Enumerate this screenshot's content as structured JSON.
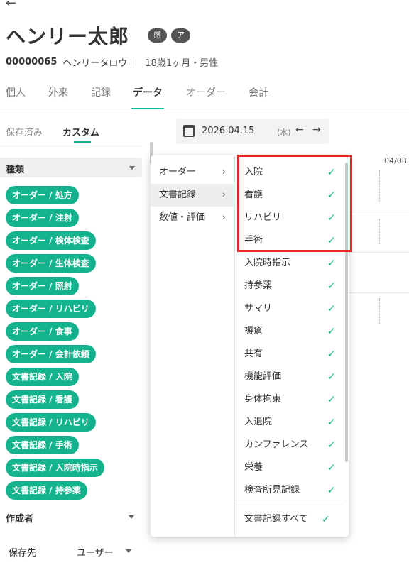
{
  "patient": {
    "name": "ヘンリー太郎",
    "tags": [
      "感",
      "ア"
    ],
    "id": "00000065",
    "kana": "ヘンリータロウ",
    "age_sex": "18歳1ヶ月・男性"
  },
  "tabs": [
    "個人",
    "外来",
    "記録",
    "データ",
    "オーダー",
    "会計"
  ],
  "active_tab": "データ",
  "subtabs": [
    "保存済み",
    "カスタム"
  ],
  "filters": {
    "category_label": "種類",
    "chips": [
      "オーダー / 処方",
      "オーダー / 注射",
      "オーダー / 検体検査",
      "オーダー / 生体検査",
      "オーダー / 照射",
      "オーダー / リハビリ",
      "オーダー / 食事",
      "オーダー / 会計依頼",
      "文書記録 / 入院",
      "文書記録 / 看護",
      "文書記録 / リハビリ",
      "文書記録 / 手術",
      "文書記録 / 入院時指示",
      "文書記録 / 持参薬"
    ],
    "author_label": "作成者",
    "save_label": "保存先",
    "save_value": "ユーザー"
  },
  "date_nav": {
    "date": "2026.04.15",
    "dow": "(水)",
    "prev_icon": "←",
    "next_icon": "→"
  },
  "timeline": {
    "date_label": "04/08"
  },
  "menu": {
    "categories": [
      "オーダー",
      "文書記録",
      "数値・評価"
    ],
    "active_category": "文書記録",
    "items": [
      "入院",
      "看護",
      "リハビリ",
      "手術",
      "入院時指示",
      "持参薬",
      "サマリ",
      "褥瘡",
      "共有",
      "機能評価",
      "身体拘束",
      "入退院",
      "カンファレンス",
      "栄養",
      "検査所見記録"
    ],
    "all_item": "文書記録すべて",
    "check_glyph": "✓",
    "chevron_glyph": "›"
  },
  "icons": {
    "back": "←"
  },
  "colors": {
    "accent": "#14b38d",
    "highlight": "#e62525"
  }
}
